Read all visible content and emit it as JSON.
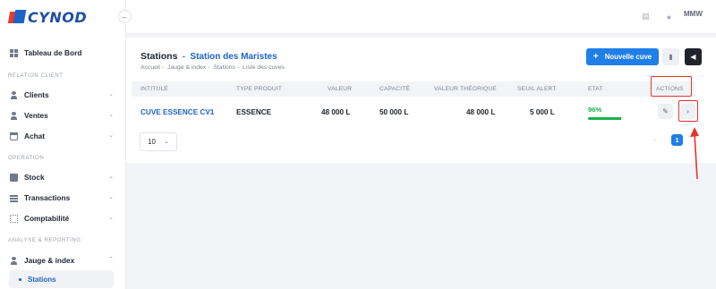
{
  "app": {
    "logo_text": "CYNOD",
    "user_initials": "MMW"
  },
  "sidebar": {
    "top_item": {
      "label": "Tableau de Bord",
      "icon": "dashboard-icon"
    },
    "sections": [
      {
        "title": "RELATION CLIENT",
        "items": [
          {
            "label": "Clients",
            "icon": "person-icon"
          },
          {
            "label": "Ventes",
            "icon": "sales-icon"
          },
          {
            "label": "Achat",
            "icon": "basket-icon"
          }
        ]
      },
      {
        "title": "OPERATION",
        "items": [
          {
            "label": "Stock",
            "icon": "box-icon"
          },
          {
            "label": "Transactions",
            "icon": "layers-icon"
          },
          {
            "label": "Comptabilité",
            "icon": "calculator-icon"
          }
        ]
      },
      {
        "title": "ANALYSE & REPORTING",
        "items": [
          {
            "label": "Jauge & index",
            "icon": "gauge-icon"
          }
        ]
      }
    ],
    "active_sub": "Stations"
  },
  "header": {
    "title": "Stations",
    "subtitle": "Station des Maristes",
    "breadcrumb": [
      "Accueil",
      "Jauge & index",
      "Stations",
      "Liste des cuves"
    ],
    "new_button": "Nouvelle cuve"
  },
  "table": {
    "columns": [
      "INTITULÉ",
      "TYPE PRODUIT",
      "VALEUR",
      "CAPACITÉ",
      "VALEUR THÉORIQUE",
      "SEUIL ALERT",
      "ETAT",
      "ACTIONS"
    ],
    "row": {
      "intitule": "CUVE ESSENCE CV1",
      "type_produit": "ESSENCE",
      "valeur": "48 000 L",
      "capacite": "50 000 L",
      "valeur_theorique": "48 000 L",
      "seuil_alert": "5 000 L",
      "etat": "96%",
      "etat_fraction": 0.96
    }
  },
  "pagination": {
    "page_size": "10",
    "current_page": "1"
  },
  "colors": {
    "accent": "#1e7fe8",
    "success": "#17b34a",
    "annotation": "#e8322c"
  }
}
